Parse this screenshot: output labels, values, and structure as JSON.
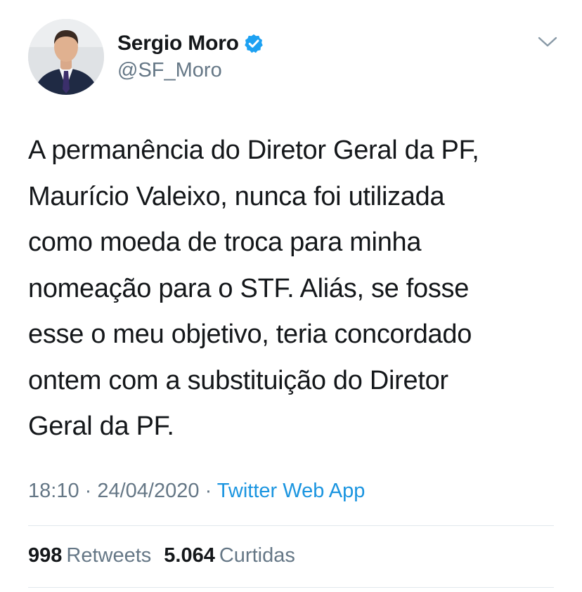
{
  "author": {
    "display_name": "Sergio Moro",
    "handle": "@SF_Moro",
    "verified_icon": "verified-badge-icon",
    "avatar_icon": "profile-photo"
  },
  "menu": {
    "icon": "chevron-down-icon"
  },
  "tweet": {
    "text": "A permanência do Diretor Geral da PF,\nMaurício Valeixo, nunca foi utilizada\ncomo moeda de troca para minha\nnomeação para o STF. Aliás, se fosse\nesse o meu objetivo, teria concordado\nontem com a substituição do Diretor\nGeral da PF."
  },
  "meta": {
    "time": "18:10",
    "separator": " · ",
    "date": "24/04/2020",
    "source": "Twitter Web App"
  },
  "stats": {
    "retweets_count": "998",
    "retweets_label": "Retweets",
    "likes_count": "5.064",
    "likes_label": "Curtidas"
  },
  "colors": {
    "text": "#14171a",
    "secondary": "#657786",
    "link": "#1b95e0",
    "verified": "#1da1f2",
    "divider": "#e1e8ed"
  }
}
